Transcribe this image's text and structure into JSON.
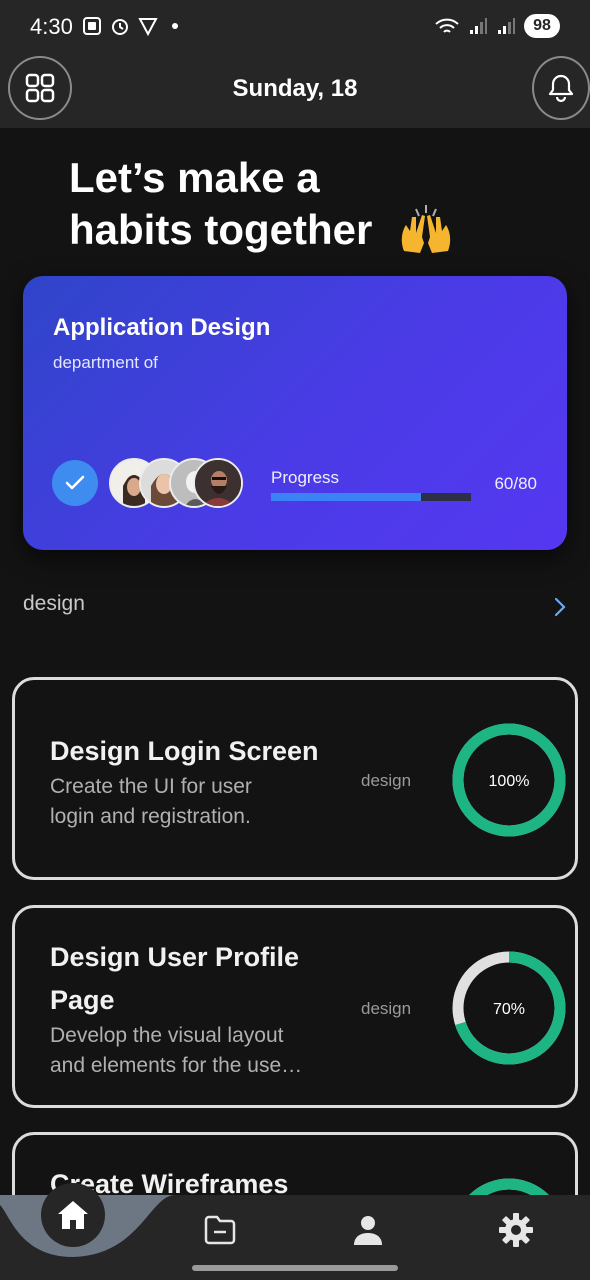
{
  "status_bar": {
    "time": "4:30",
    "battery": "98"
  },
  "app_bar": {
    "date": "Sunday, 18"
  },
  "hero": {
    "line1": "Let’s make a",
    "line2": "habits together",
    "emoji": "🙌"
  },
  "project_card": {
    "title": "Application Design",
    "subtitle": "department of",
    "progress_label": "Progress",
    "progress_value": "60/80",
    "progress_fraction": 0.75,
    "gradient": [
      "#2f45c9",
      "#5538f2"
    ]
  },
  "section": {
    "label": "design"
  },
  "tasks": [
    {
      "title_lines": [
        "Design Login Screen"
      ],
      "desc_lines": [
        "Create the UI for user",
        "login and registration."
      ],
      "tag": "design",
      "percent_label": "100%",
      "percent": 100
    },
    {
      "title_lines": [
        "Design User Profile",
        "Page"
      ],
      "desc_lines": [
        "Develop the visual layout",
        "and elements for the use…"
      ],
      "tag": "design",
      "percent_label": "70%",
      "percent": 70
    },
    {
      "title_lines": [
        "Create Wireframes"
      ],
      "desc_lines": [],
      "tag": "",
      "percent_label": "",
      "percent": 100
    }
  ],
  "colors": {
    "ring_fill": "#1db584",
    "ring_track": "#e0e0e0",
    "accent": "#3b82f6"
  },
  "bottom_nav": {
    "items": [
      "home-icon",
      "folder-icon",
      "person-icon",
      "gear-icon"
    ]
  }
}
